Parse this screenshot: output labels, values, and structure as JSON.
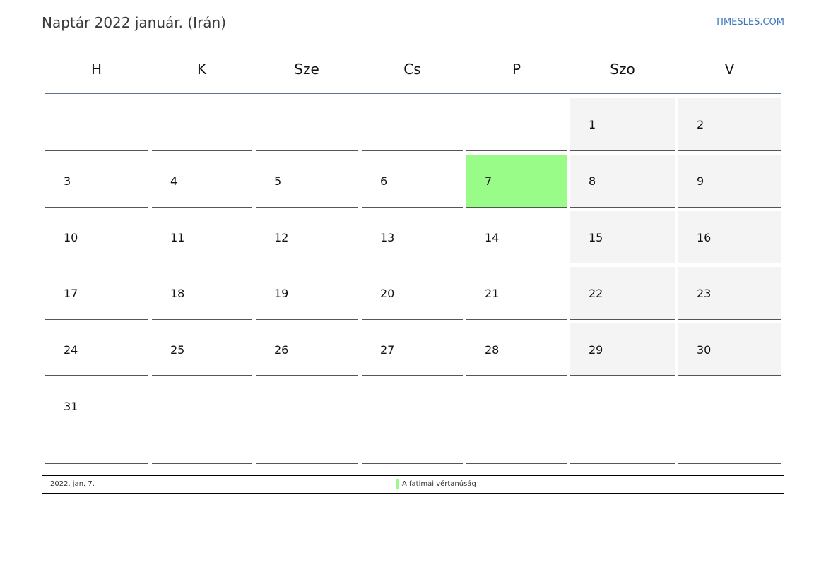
{
  "header": {
    "title": "Naptár 2022 január. (Irán)",
    "site": "TIMESLES.COM"
  },
  "weekdays": [
    "H",
    "K",
    "Sze",
    "Cs",
    "P",
    "Szo",
    "V"
  ],
  "weeks": [
    [
      "",
      "",
      "",
      "",
      "",
      "1",
      "2"
    ],
    [
      "3",
      "4",
      "5",
      "6",
      "7",
      "8",
      "9"
    ],
    [
      "10",
      "11",
      "12",
      "13",
      "14",
      "15",
      "16"
    ],
    [
      "17",
      "18",
      "19",
      "20",
      "21",
      "22",
      "23"
    ],
    [
      "24",
      "25",
      "26",
      "27",
      "28",
      "29",
      "30"
    ],
    [
      "31",
      "",
      "",
      "",
      "",
      "",
      ""
    ]
  ],
  "holidays": [
    "7"
  ],
  "colors": {
    "holiday": "#99fb88",
    "weekend": "#f4f4f4",
    "accent": "#5a7394",
    "site_link": "#3a78b8"
  },
  "legend": {
    "date": "2022. jan. 7.",
    "name": "A fatimai vértanúság"
  }
}
